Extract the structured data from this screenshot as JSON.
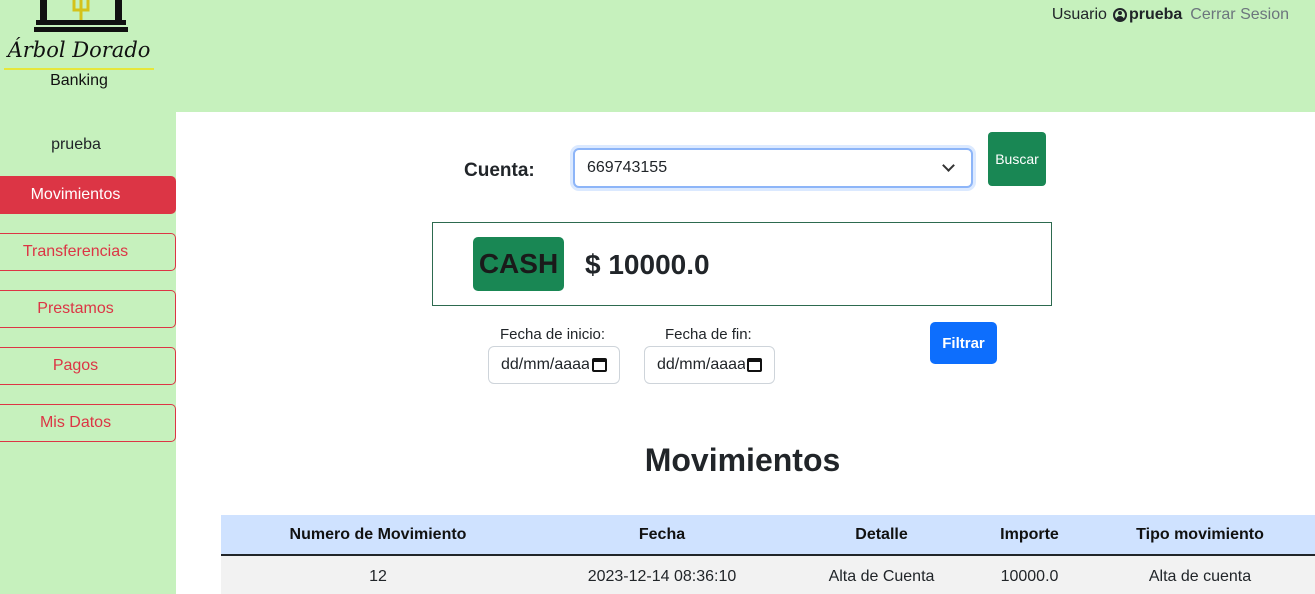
{
  "brand": {
    "name": "Árbol Dorado",
    "subtitle": "Banking"
  },
  "header": {
    "user_label": "Usuario",
    "username": "prueba",
    "logout": "Cerrar Sesion"
  },
  "sidebar": {
    "user": "prueba",
    "items": [
      {
        "label": "Movimientos",
        "active": true
      },
      {
        "label": "Transferencias",
        "active": false
      },
      {
        "label": "Prestamos",
        "active": false
      },
      {
        "label": "Pagos",
        "active": false
      },
      {
        "label": "Mis Datos",
        "active": false
      }
    ]
  },
  "account": {
    "label": "Cuenta:",
    "selected": "669743155",
    "search_button": "Buscar"
  },
  "balance": {
    "badge": "CASH",
    "amount": "$ 10000.0"
  },
  "filter": {
    "start_label": "Fecha de inicio:",
    "start_placeholder": "dd/mm/aaaa",
    "end_label": "Fecha de fin:",
    "end_placeholder": "dd/mm/aaaa",
    "button": "Filtrar"
  },
  "movements": {
    "title": "Movimientos",
    "columns": [
      "Numero de Movimiento",
      "Fecha",
      "Detalle",
      "Importe",
      "Tipo movimiento"
    ],
    "rows": [
      [
        "12",
        "2023-12-14 08:36:10",
        "Alta de Cuenta",
        "10000.0",
        "Alta de cuenta"
      ]
    ]
  },
  "colors": {
    "header_bg": "#c6f1bd",
    "danger": "#dc3545",
    "success": "#198754",
    "primary": "#0d6efd",
    "table_head": "#cfe2ff"
  }
}
